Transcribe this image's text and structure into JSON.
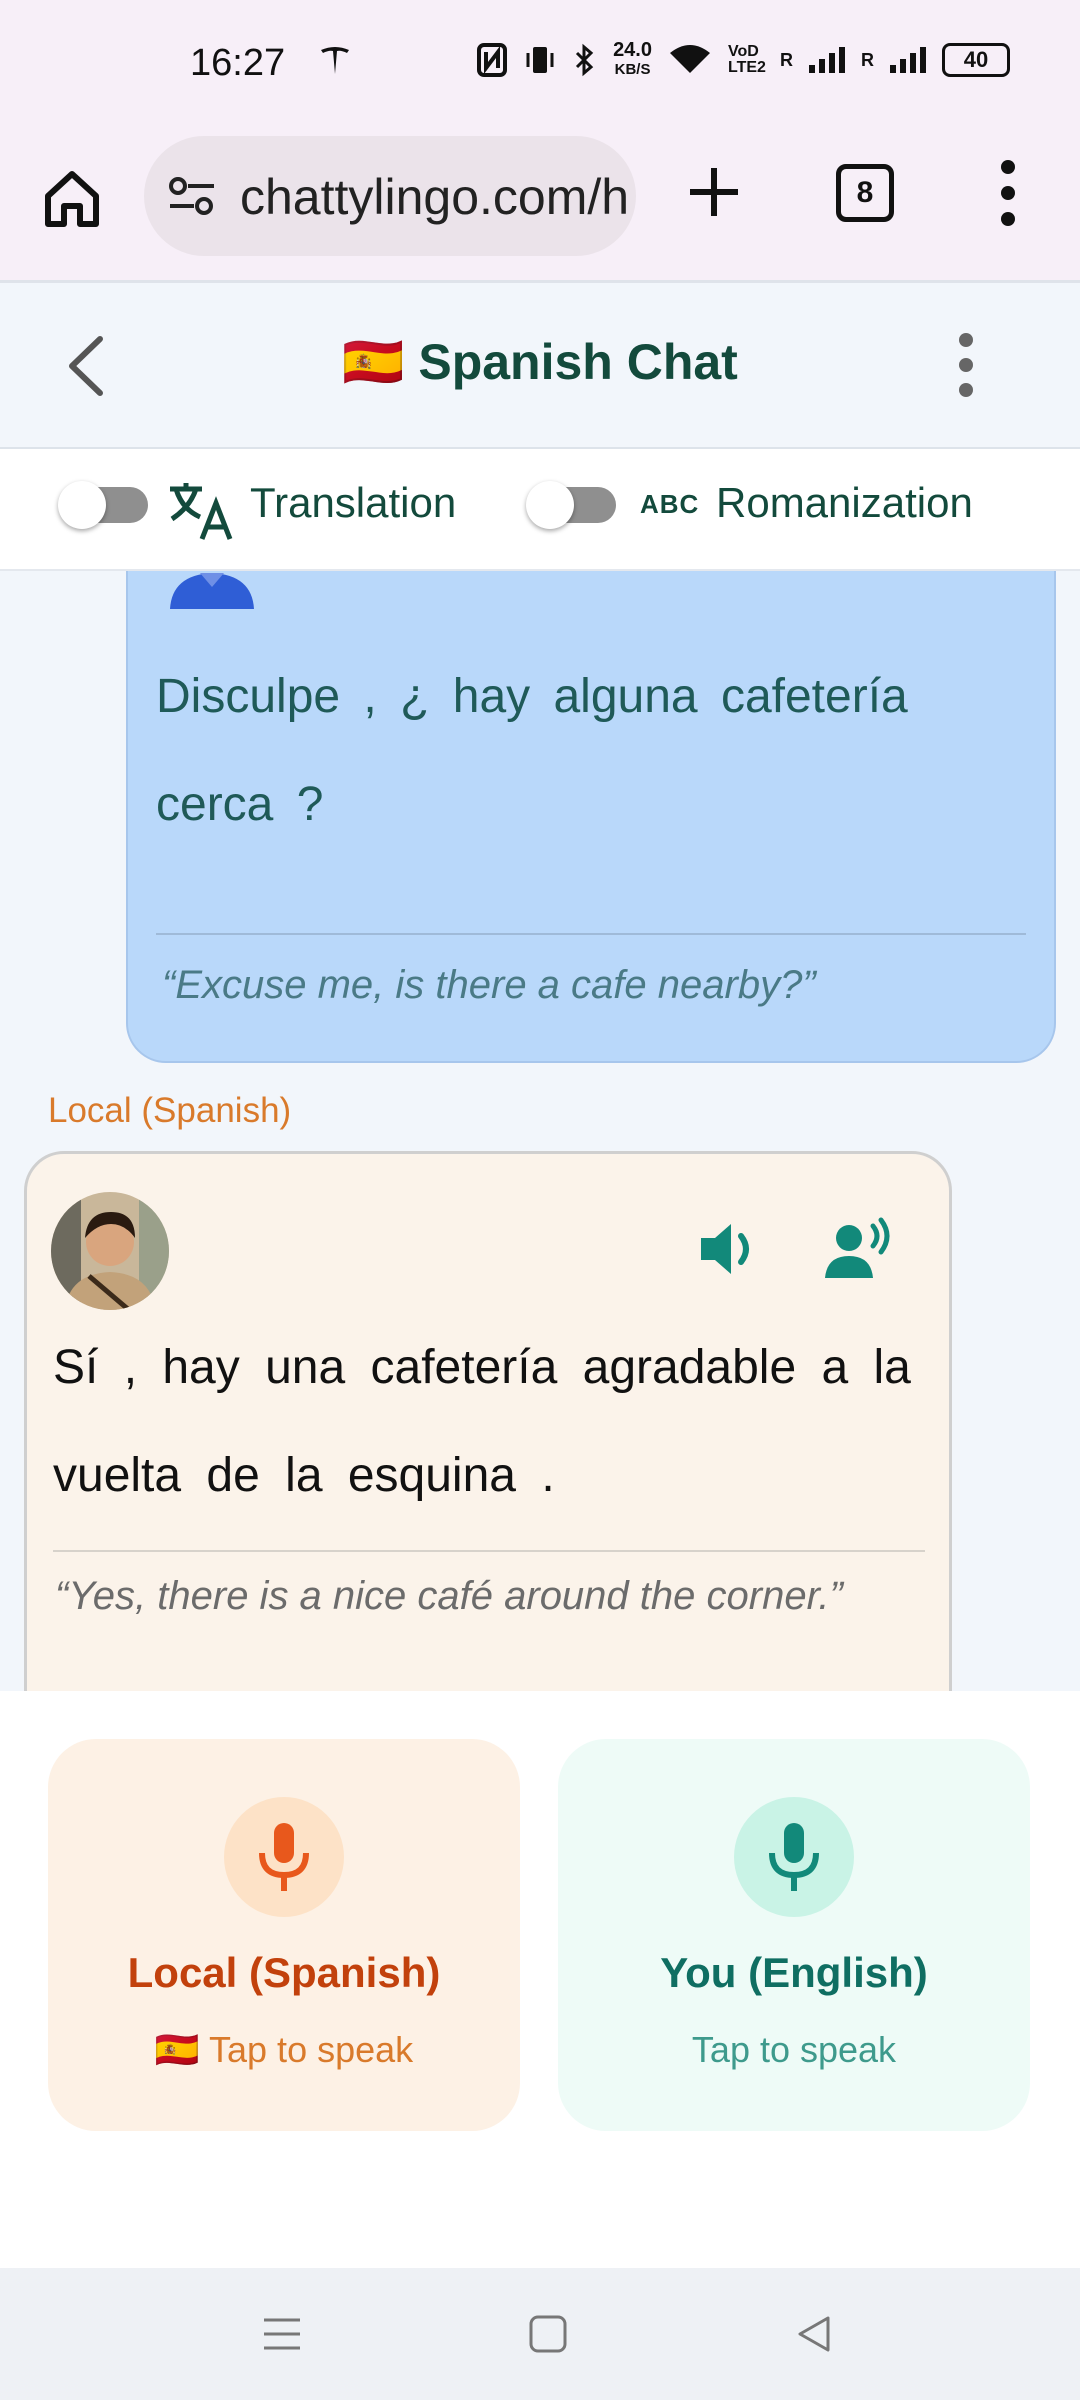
{
  "status": {
    "time": "16:27",
    "network_speed": "24.0",
    "network_unit": "KB/S",
    "volte": "VoD LTE2",
    "sim_label": "R",
    "battery": "40"
  },
  "browser": {
    "url": "chattylingo.com/h",
    "tab_count": "8"
  },
  "header": {
    "flag": "🇪🇸",
    "title": "Spanish Chat"
  },
  "toggles": {
    "translation_label": "Translation",
    "romanization_label": "Romanization",
    "romanization_icon_text": "ABC",
    "translation_on": false,
    "romanization_on": false
  },
  "chat": {
    "user_message": {
      "text": "Disculpe , ¿ hay alguna cafetería cerca ?",
      "translation": "“Excuse me, is there a cafe nearby?”"
    },
    "local_message": {
      "speaker_label": "Local (Spanish)",
      "text": "Sí , hay una cafetería agradable a la vuelta de la esquina .",
      "translation": "“Yes, there is a nice café around the corner.”"
    }
  },
  "speak_panel": {
    "local": {
      "title": "Local (Spanish)",
      "flag": "🇪🇸",
      "subtitle": "Tap to speak"
    },
    "you": {
      "title": "You (English)",
      "subtitle": "Tap to speak"
    }
  },
  "colors": {
    "accent_teal": "#12897a",
    "header_green": "#134a3c",
    "local_orange": "#e8581c",
    "user_bubble": "#b9d8fa",
    "local_bubble": "#fbf3ea"
  }
}
